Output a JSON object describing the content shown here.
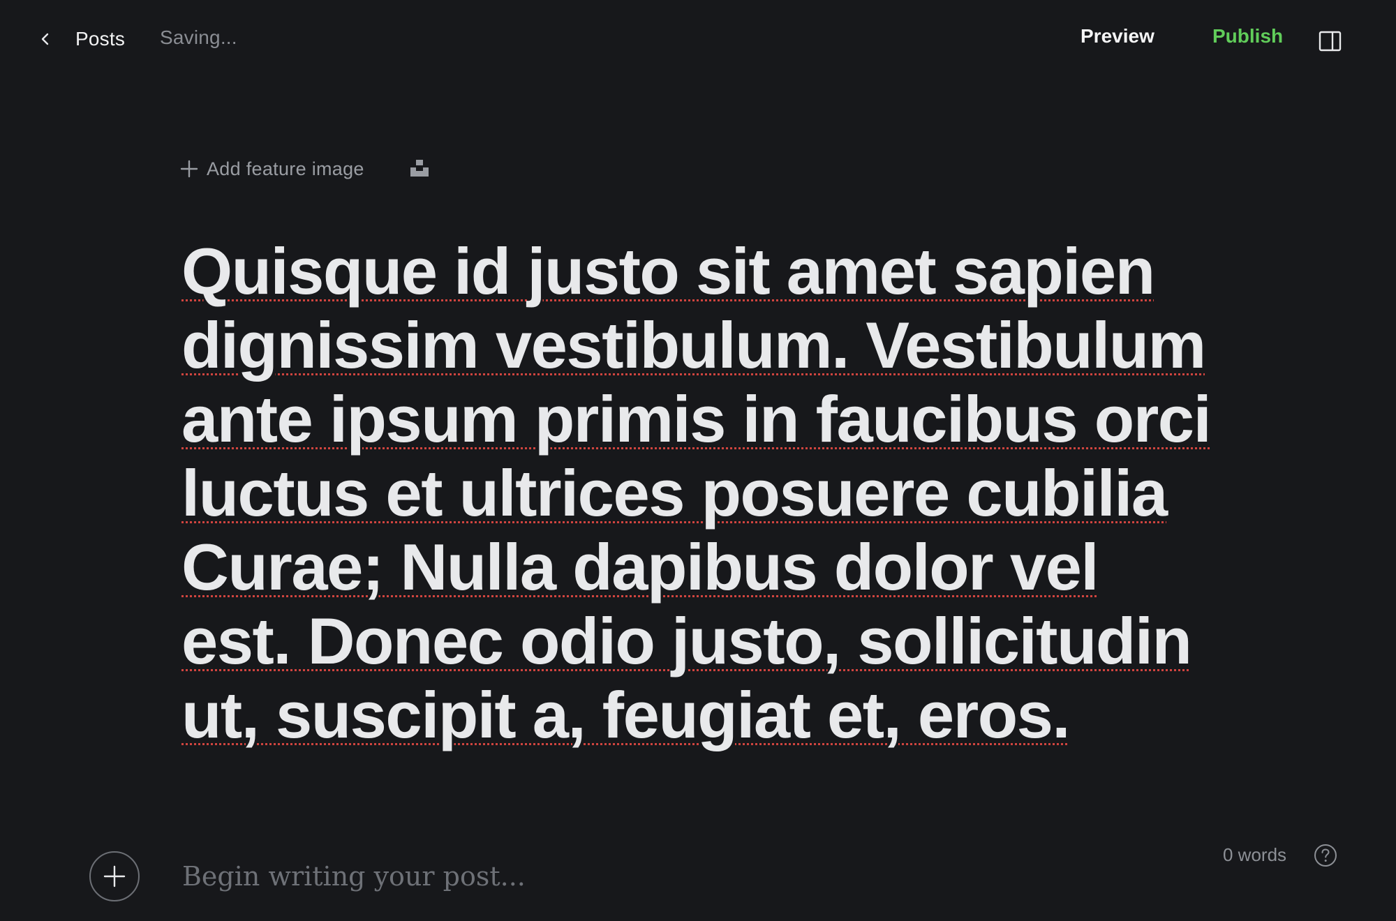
{
  "topbar": {
    "back_label": "Posts",
    "status": "Saving...",
    "preview_label": "Preview",
    "publish_label": "Publish",
    "publish_color": "#61cd5a",
    "icons": [
      "chevron-left-icon",
      "sidebar-toggle-icon"
    ]
  },
  "editor": {
    "add_feature_image_label": "Add feature image",
    "feature_icons": [
      "plus-icon",
      "unsplash-icon"
    ],
    "title": "Quisque id justo sit amet sapien dignissim vestibulum. Vestibulum ante ipsum primis in faucibus orci luctus et ultrices posuere cubilia Curae; Nulla dapibus dolor vel est. Donec odio justo, sollicitudin ut, suscipit a, feugiat et, eros.",
    "body_placeholder": "Begin writing your post...",
    "spellcheck_underline_color": "#d0443f"
  },
  "footer": {
    "word_count": "0 words",
    "icons": [
      "add-card-icon",
      "help-icon"
    ]
  }
}
